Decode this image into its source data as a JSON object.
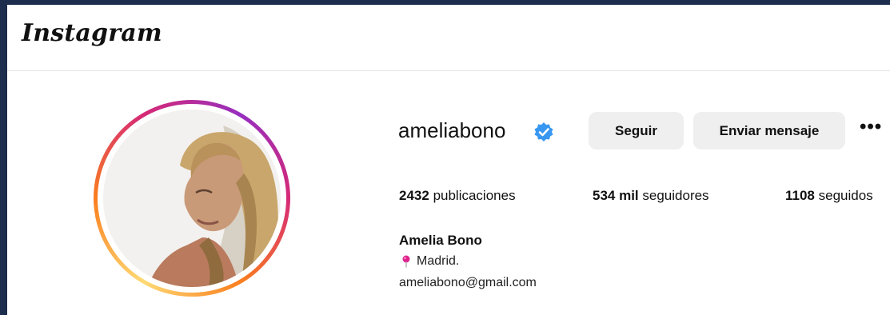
{
  "header": {
    "logo_text": "Instagram"
  },
  "profile": {
    "username": "ameliabono",
    "verified": true,
    "buttons": {
      "follow_label": "Seguir",
      "message_label": "Enviar mensaje",
      "more_label": "•••"
    },
    "stats": [
      {
        "value": "2432",
        "label": "publicaciones"
      },
      {
        "value": "534 mil",
        "label": "seguidores"
      },
      {
        "value": "1108",
        "label": "seguidos"
      }
    ],
    "full_name": "Amelia Bono",
    "location": "Madrid.",
    "email": "ameliabono@gmail.com"
  },
  "colors": {
    "page_background": "#1c2d4d",
    "verified_blue": "#3897f0",
    "button_bg": "#efefef",
    "location_pin": "#e0248e"
  },
  "icons": {
    "verified": "verified-badge-icon",
    "location": "location-pin-icon",
    "more": "more-options-icon"
  }
}
